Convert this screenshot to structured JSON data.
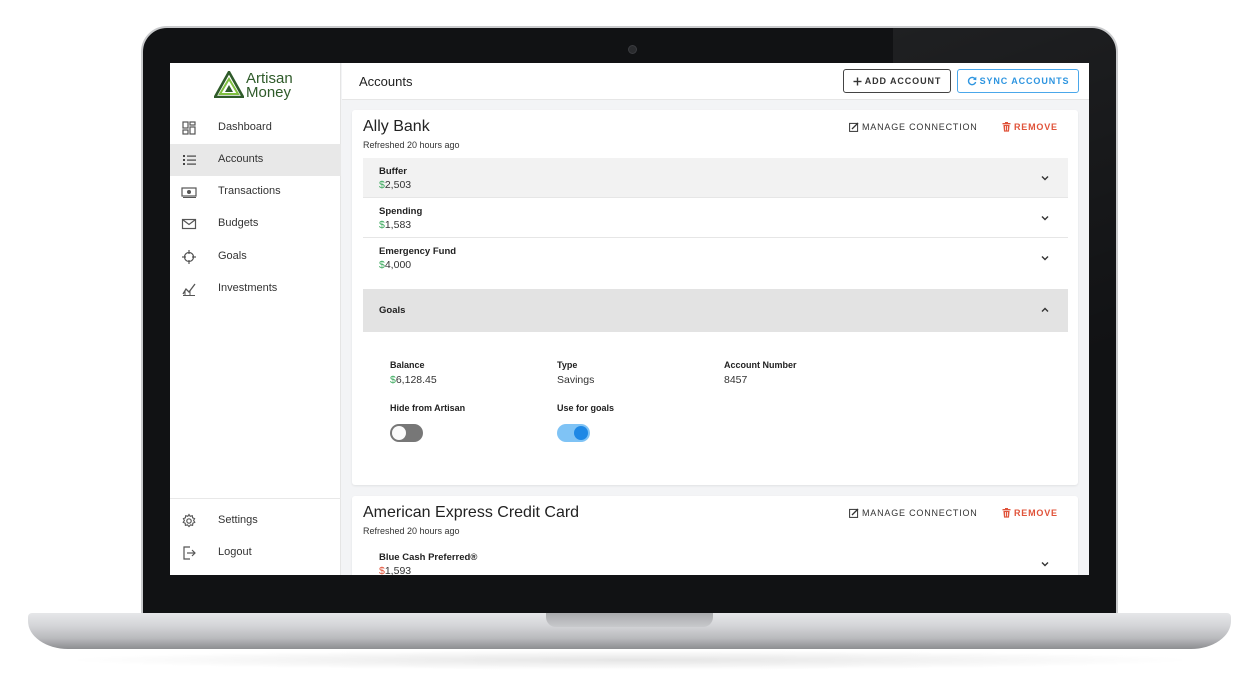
{
  "app": {
    "logo_line1": "Artisan",
    "logo_line2": "Money",
    "brand_color": "#2f5b2a"
  },
  "sidebar": {
    "items": [
      {
        "label": "Dashboard",
        "icon": "dashboard-icon",
        "active": false
      },
      {
        "label": "Accounts",
        "icon": "list-icon",
        "active": true
      },
      {
        "label": "Transactions",
        "icon": "cash-icon",
        "active": false
      },
      {
        "label": "Budgets",
        "icon": "envelope-icon",
        "active": false
      },
      {
        "label": "Goals",
        "icon": "crosshair-icon",
        "active": false
      },
      {
        "label": "Investments",
        "icon": "chart-line-icon",
        "active": false
      }
    ],
    "bottom_items": [
      {
        "label": "Settings",
        "icon": "gear-icon"
      },
      {
        "label": "Logout",
        "icon": "logout-icon"
      }
    ]
  },
  "header": {
    "title": "Accounts",
    "add_account_label": "ADD ACCOUNT",
    "sync_accounts_label": "SYNC ACCOUNTS",
    "accent_color": "#2e95e0"
  },
  "banks": [
    {
      "name": "Ally Bank",
      "refreshed": "Refreshed 20 hours ago",
      "manage_label": "MANAGE CONNECTION",
      "remove_label": "REMOVE",
      "accounts": [
        {
          "name": "Buffer",
          "currency": "$",
          "balance": "2,503",
          "expanded": false
        },
        {
          "name": "Spending",
          "currency": "$",
          "balance": "1,583",
          "expanded": false
        },
        {
          "name": "Emergency Fund",
          "currency": "$",
          "balance": "4,000",
          "expanded": false
        }
      ],
      "expanded_account": {
        "name": "Goals",
        "balance_label": "Balance",
        "balance_currency": "$",
        "balance_value": "6,128.45",
        "type_label": "Type",
        "type_value": "Savings",
        "number_label": "Account Number",
        "number_value": "8457",
        "hide_label": "Hide from Artisan",
        "hide_on": false,
        "goals_label": "Use for goals",
        "goals_on": true
      }
    },
    {
      "name": "American Express Credit Card",
      "refreshed": "Refreshed 20 hours ago",
      "manage_label": "MANAGE CONNECTION",
      "remove_label": "REMOVE",
      "accounts": [
        {
          "name": "Blue Cash Preferred®",
          "currency": "$",
          "balance": "1,593",
          "expanded": false
        }
      ]
    }
  ],
  "colors": {
    "positive": "#3caa5e",
    "negative": "#e0533a",
    "toggle_on": "#1e88e5"
  }
}
